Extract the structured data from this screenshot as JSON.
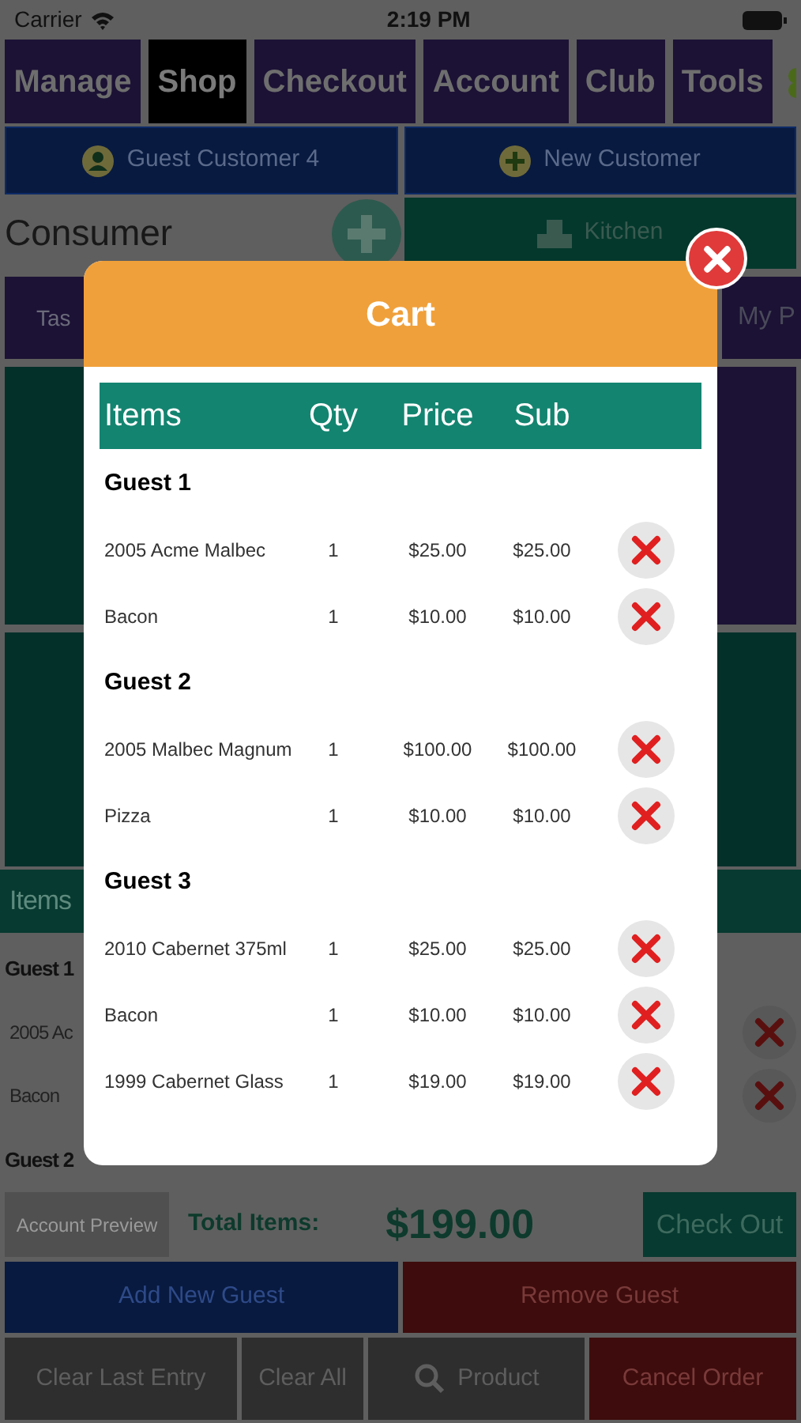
{
  "status_bar": {
    "carrier": "Carrier",
    "time": "2:19 PM"
  },
  "tabs": [
    {
      "label": "Manage",
      "selected": false
    },
    {
      "label": "Shop",
      "selected": true
    },
    {
      "label": "Checkout",
      "selected": false
    },
    {
      "label": "Account",
      "selected": false
    },
    {
      "label": "Club",
      "selected": false
    },
    {
      "label": "Tools",
      "selected": false
    }
  ],
  "customer_buttons": [
    {
      "label": "Guest Customer 4",
      "kind": "person"
    },
    {
      "label": "New Customer",
      "kind": "add"
    }
  ],
  "consumer": {
    "label": "Consumer"
  },
  "kitchen": {
    "label": "Kitchen"
  },
  "tiles": [
    "Tas",
    "My P"
  ],
  "items_bar": {
    "label": "Items"
  },
  "order_list": [
    {
      "kind": "guest",
      "label": "Guest 1"
    },
    {
      "kind": "item",
      "label": "2005 Ac"
    },
    {
      "kind": "item",
      "label": "Bacon"
    },
    {
      "kind": "guest",
      "label": "Guest 2"
    }
  ],
  "footer": {
    "account_preview": "Account Preview",
    "total_label": "Total Items:",
    "total": "$199.00",
    "check_out": "Check Out",
    "add_guest": "Add New Guest",
    "remove_guest": "Remove Guest",
    "actions": [
      {
        "label": "Clear Last Entry",
        "kind": "plain"
      },
      {
        "label": "Clear All",
        "kind": "plain"
      },
      {
        "label": "Product",
        "kind": "search"
      },
      {
        "label": "Cancel Order",
        "kind": "danger"
      }
    ]
  },
  "cart": {
    "title": "Cart",
    "columns": [
      "Items",
      "Qty",
      "Price",
      "Sub"
    ],
    "guests": [
      {
        "name": "Guest 1",
        "items": [
          {
            "name": "2005 Acme Malbec",
            "qty": "1",
            "price": "$25.00",
            "sub": "$25.00"
          },
          {
            "name": "Bacon",
            "qty": "1",
            "price": "$10.00",
            "sub": "$10.00"
          }
        ]
      },
      {
        "name": "Guest 2",
        "items": [
          {
            "name": "2005 Malbec Magnum",
            "qty": "1",
            "price": "$100.00",
            "sub": "$100.00"
          },
          {
            "name": "Pizza",
            "qty": "1",
            "price": "$10.00",
            "sub": "$10.00"
          }
        ]
      },
      {
        "name": "Guest 3",
        "items": [
          {
            "name": "2010 Cabernet 375ml",
            "qty": "1",
            "price": "$25.00",
            "sub": "$25.00"
          },
          {
            "name": "Bacon",
            "qty": "1",
            "price": "$10.00",
            "sub": "$10.00"
          },
          {
            "name": "1999 Cabernet Glass",
            "qty": "1",
            "price": "$19.00",
            "sub": "$19.00"
          }
        ]
      }
    ]
  }
}
